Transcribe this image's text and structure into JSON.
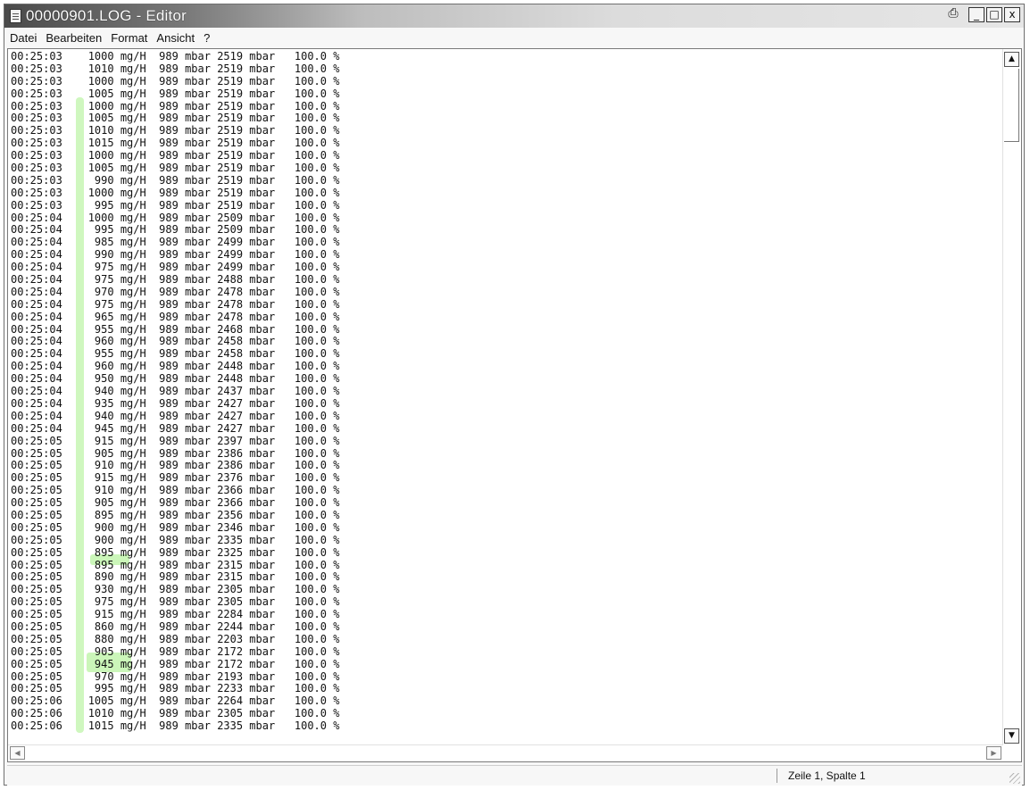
{
  "window": {
    "title": "00000901.LOG - Editor",
    "controls": {
      "print": "⎙",
      "minimize": "_",
      "maximize": "□",
      "close": "x"
    }
  },
  "menu": [
    "Datei",
    "Bearbeiten",
    "Format",
    "Ansicht",
    "?"
  ],
  "log_lines": [
    "00:25:03    1000 mg/H  989 mbar 2519 mbar   100.0 %",
    "00:25:03    1010 mg/H  989 mbar 2519 mbar   100.0 %",
    "00:25:03    1000 mg/H  989 mbar 2519 mbar   100.0 %",
    "00:25:03    1005 mg/H  989 mbar 2519 mbar   100.0 %",
    "00:25:03    1000 mg/H  989 mbar 2519 mbar   100.0 %",
    "00:25:03    1005 mg/H  989 mbar 2519 mbar   100.0 %",
    "00:25:03    1010 mg/H  989 mbar 2519 mbar   100.0 %",
    "00:25:03    1015 mg/H  989 mbar 2519 mbar   100.0 %",
    "00:25:03    1000 mg/H  989 mbar 2519 mbar   100.0 %",
    "00:25:03    1005 mg/H  989 mbar 2519 mbar   100.0 %",
    "00:25:03     990 mg/H  989 mbar 2519 mbar   100.0 %",
    "00:25:03    1000 mg/H  989 mbar 2519 mbar   100.0 %",
    "00:25:03     995 mg/H  989 mbar 2519 mbar   100.0 %",
    "00:25:04    1000 mg/H  989 mbar 2509 mbar   100.0 %",
    "00:25:04     995 mg/H  989 mbar 2509 mbar   100.0 %",
    "00:25:04     985 mg/H  989 mbar 2499 mbar   100.0 %",
    "00:25:04     990 mg/H  989 mbar 2499 mbar   100.0 %",
    "00:25:04     975 mg/H  989 mbar 2499 mbar   100.0 %",
    "00:25:04     975 mg/H  989 mbar 2488 mbar   100.0 %",
    "00:25:04     970 mg/H  989 mbar 2478 mbar   100.0 %",
    "00:25:04     975 mg/H  989 mbar 2478 mbar   100.0 %",
    "00:25:04     965 mg/H  989 mbar 2478 mbar   100.0 %",
    "00:25:04     955 mg/H  989 mbar 2468 mbar   100.0 %",
    "00:25:04     960 mg/H  989 mbar 2458 mbar   100.0 %",
    "00:25:04     955 mg/H  989 mbar 2458 mbar   100.0 %",
    "00:25:04     960 mg/H  989 mbar 2448 mbar   100.0 %",
    "00:25:04     950 mg/H  989 mbar 2448 mbar   100.0 %",
    "00:25:04     940 mg/H  989 mbar 2437 mbar   100.0 %",
    "00:25:04     935 mg/H  989 mbar 2427 mbar   100.0 %",
    "00:25:04     940 mg/H  989 mbar 2427 mbar   100.0 %",
    "00:25:04     945 mg/H  989 mbar 2427 mbar   100.0 %",
    "00:25:05     915 mg/H  989 mbar 2397 mbar   100.0 %",
    "00:25:05     905 mg/H  989 mbar 2386 mbar   100.0 %",
    "00:25:05     910 mg/H  989 mbar 2386 mbar   100.0 %",
    "00:25:05     915 mg/H  989 mbar 2376 mbar   100.0 %",
    "00:25:05     910 mg/H  989 mbar 2366 mbar   100.0 %",
    "00:25:05     905 mg/H  989 mbar 2366 mbar   100.0 %",
    "00:25:05     895 mg/H  989 mbar 2356 mbar   100.0 %",
    "00:25:05     900 mg/H  989 mbar 2346 mbar   100.0 %",
    "00:25:05     900 mg/H  989 mbar 2335 mbar   100.0 %",
    "00:25:05     895 mg/H  989 mbar 2325 mbar   100.0 %",
    "00:25:05     895 mg/H  989 mbar 2315 mbar   100.0 %",
    "00:25:05     890 mg/H  989 mbar 2315 mbar   100.0 %",
    "00:25:05     930 mg/H  989 mbar 2305 mbar   100.0 %",
    "00:25:05     975 mg/H  989 mbar 2305 mbar   100.0 %",
    "00:25:05     915 mg/H  989 mbar 2284 mbar   100.0 %",
    "00:25:05     860 mg/H  989 mbar 2244 mbar   100.0 %",
    "00:25:05     880 mg/H  989 mbar 2203 mbar   100.0 %",
    "00:25:05     905 mg/H  989 mbar 2172 mbar   100.0 %",
    "00:25:05     945 mg/H  989 mbar 2172 mbar   100.0 %",
    "00:25:05     970 mg/H  989 mbar 2193 mbar   100.0 %",
    "00:25:05     995 mg/H  989 mbar 2233 mbar   100.0 %",
    "00:25:06    1005 mg/H  989 mbar 2264 mbar   100.0 %",
    "00:25:06    1010 mg/H  989 mbar 2305 mbar   100.0 %",
    "00:25:06    1015 mg/H  989 mbar 2335 mbar   100.0 %"
  ],
  "status": {
    "position": "Zeile 1, Spalte 1"
  },
  "highlight_color": "#a8f08a"
}
